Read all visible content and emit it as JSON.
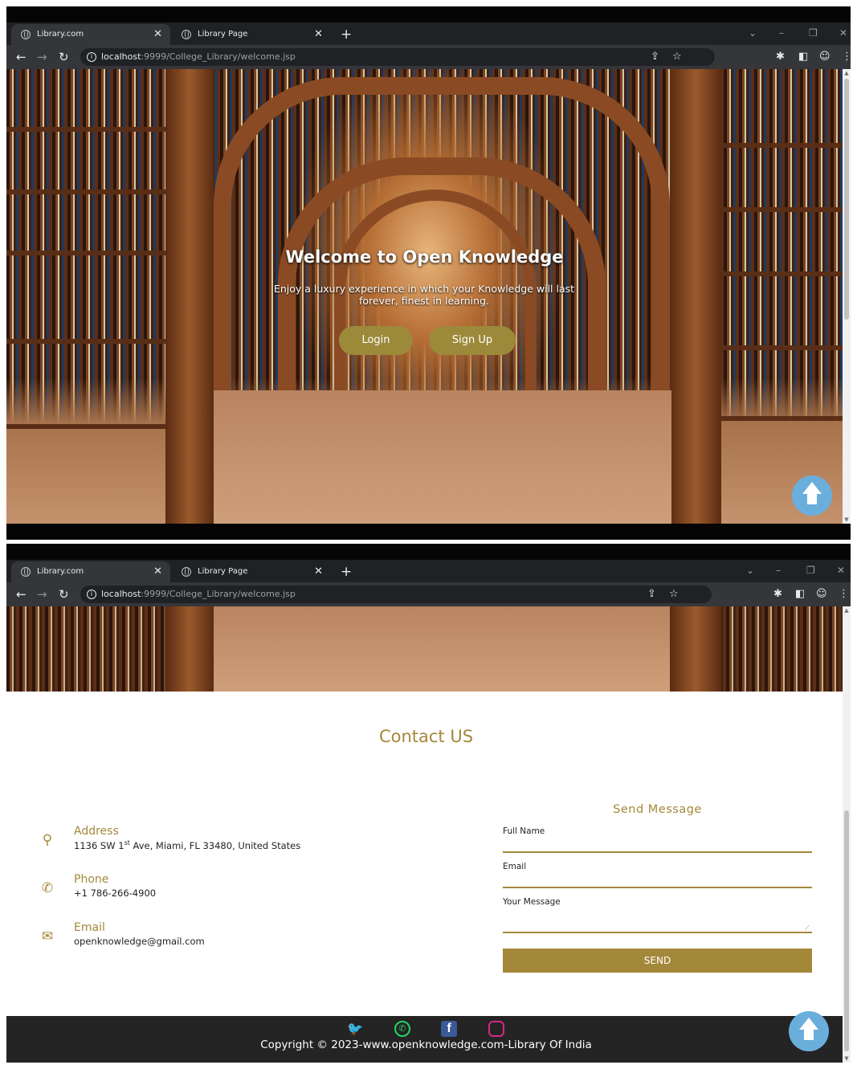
{
  "browser": {
    "tabs": [
      {
        "label": "Library.com",
        "active": true
      },
      {
        "label": "Library Page",
        "active": false
      }
    ],
    "new_tab_glyph": "+",
    "close_glyph": "✕",
    "url_host": "localhost",
    "url_rest": ":9999/College_Library/welcome.jsp",
    "window_controls": [
      "⌄",
      "–",
      "❐",
      "✕"
    ],
    "nav_icons": [
      "back-icon",
      "forward-icon",
      "reload-icon"
    ],
    "toolbar_icons": [
      "share-icon",
      "star-icon",
      "extensions-icon",
      "side-panel-icon",
      "profile-icon",
      "menu-icon"
    ]
  },
  "hero": {
    "title": "Welcome to Open Knowledge",
    "subtitle": "Enjoy a luxury experience in which your Knowledge will last forever, finest in learning.",
    "login_label": "Login",
    "signup_label": "Sign Up"
  },
  "contact": {
    "title": "Contact US",
    "address_title": "Address",
    "address_part1": "1136 SW 1",
    "address_sup": "st",
    "address_part2": " Ave, Miami, FL 33480, United States",
    "phone_title": "Phone",
    "phone_value": "+1 786-266-4900",
    "email_title": "Email",
    "email_value": "openknowledge@gmail.com"
  },
  "form": {
    "title": "Send Message",
    "full_name_label": "Full Name",
    "email_label": "Email",
    "message_label": "Your Message",
    "send_label": "SEND"
  },
  "footer": {
    "copyright": "Copyright © 2023-www.openknowledge.com-Library Of India",
    "social_icons": [
      "twitter-icon",
      "whatsapp-icon",
      "facebook-icon",
      "instagram-icon"
    ]
  },
  "colors": {
    "accent": "#a4883a",
    "hero_button": "#9c8a3a",
    "footer_bg": "#242424",
    "scroll_top_button": "#6aaedc"
  }
}
